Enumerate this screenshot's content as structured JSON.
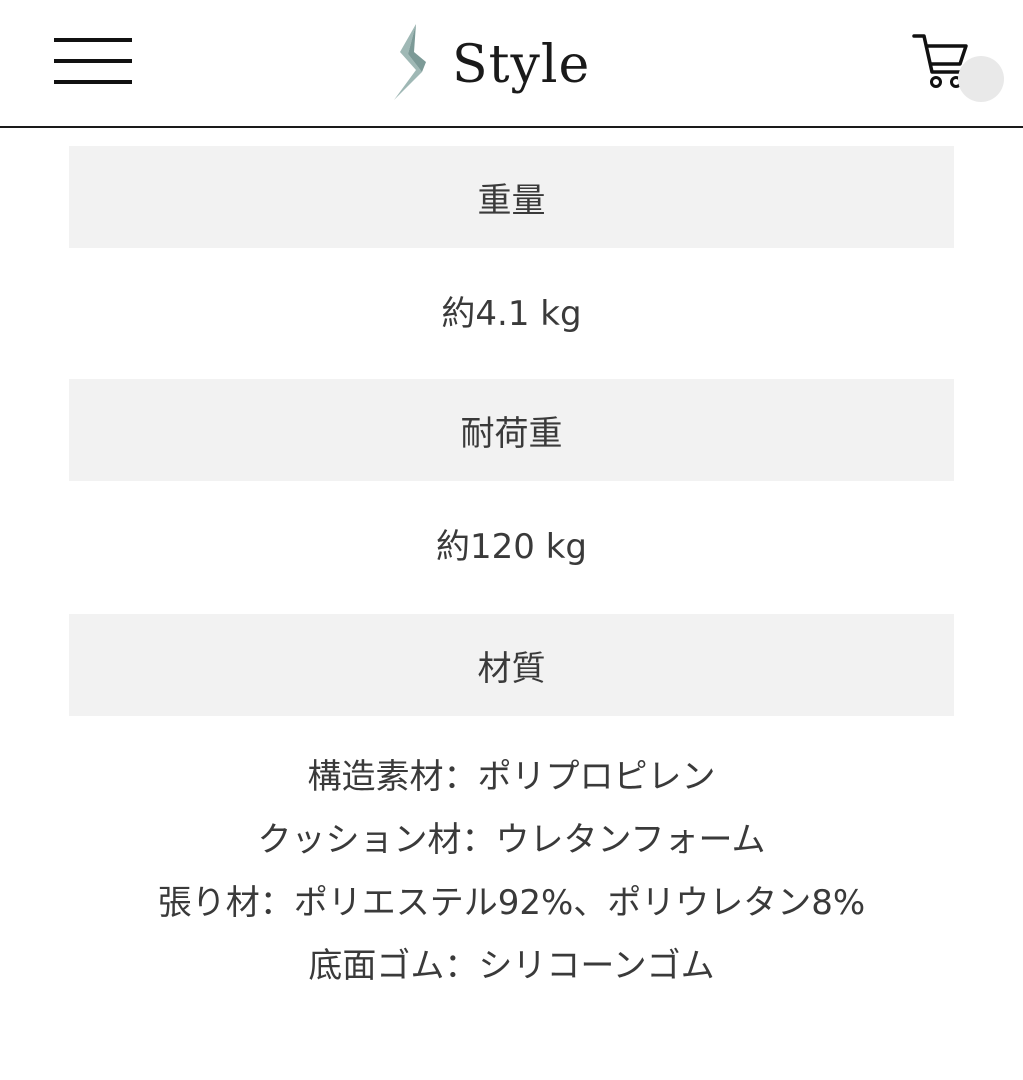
{
  "header": {
    "brand": "Style",
    "menu_icon": "hamburger-menu-icon",
    "logo_icon": "style-logo-mark-icon",
    "cart_icon": "shopping-cart-icon",
    "accent_color": "#9fb8b5"
  },
  "specs": [
    {
      "label": "重量",
      "value": "約4.1 kg"
    },
    {
      "label": "耐荷重",
      "value": "約120 kg"
    },
    {
      "label": "材質"
    }
  ],
  "materials": [
    "構造素材：ポリプロピレン",
    "クッション材：ウレタンフォーム",
    "張り材：ポリエステル92%、ポリウレタン8%",
    "底面ゴム：シリコーンゴム"
  ]
}
